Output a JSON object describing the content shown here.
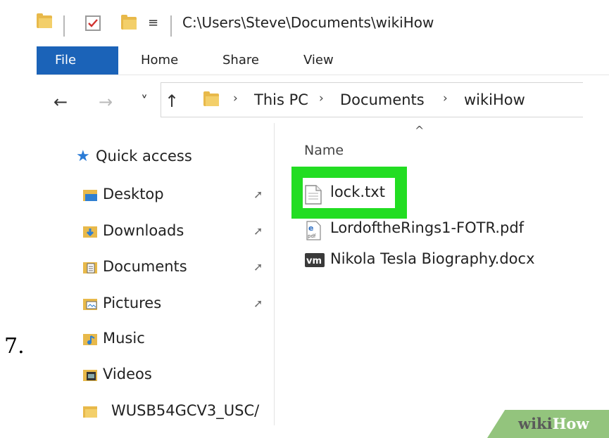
{
  "step_number": "7.",
  "window": {
    "title_path": "C:\\Users\\Steve\\Documents\\wikiHow"
  },
  "ribbon": {
    "tabs": [
      "File",
      "Home",
      "Share",
      "View"
    ],
    "active_tab": "File",
    "active_color": "#1b63b8"
  },
  "nav": {
    "back_icon": "←",
    "forward_icon": "→",
    "recent_icon": "˅",
    "up_icon": "↑",
    "breadcrumb": [
      "This PC",
      "Documents",
      "wikiHow"
    ],
    "chevron": "›"
  },
  "sidebar": {
    "quick_access": "Quick access",
    "items": [
      {
        "label": "Desktop",
        "icon": "desktop-folder-icon",
        "pinned": true
      },
      {
        "label": "Downloads",
        "icon": "downloads-folder-icon",
        "pinned": true
      },
      {
        "label": "Documents",
        "icon": "documents-folder-icon",
        "pinned": true
      },
      {
        "label": "Pictures",
        "icon": "pictures-folder-icon",
        "pinned": true
      },
      {
        "label": "Music",
        "icon": "music-folder-icon",
        "pinned": false
      },
      {
        "label": "Videos",
        "icon": "videos-folder-icon",
        "pinned": false
      },
      {
        "label": "WUSB54GCV3_USC/",
        "icon": "folder-icon",
        "pinned": false
      }
    ]
  },
  "content": {
    "column_header": "Name",
    "sort_caret": "^",
    "files": [
      {
        "name": "lock.txt",
        "icon": "text-file-icon",
        "highlighted": true
      },
      {
        "name": "LordoftheRings1-FOTR.pdf",
        "icon": "pdf-file-icon",
        "highlighted": false
      },
      {
        "name": "Nikola Tesla Biography.docx",
        "icon": "vm-docx-icon",
        "highlighted": false
      }
    ],
    "highlight_color": "#22dd22"
  },
  "watermark": {
    "part1": "wiki",
    "part2": "How"
  }
}
